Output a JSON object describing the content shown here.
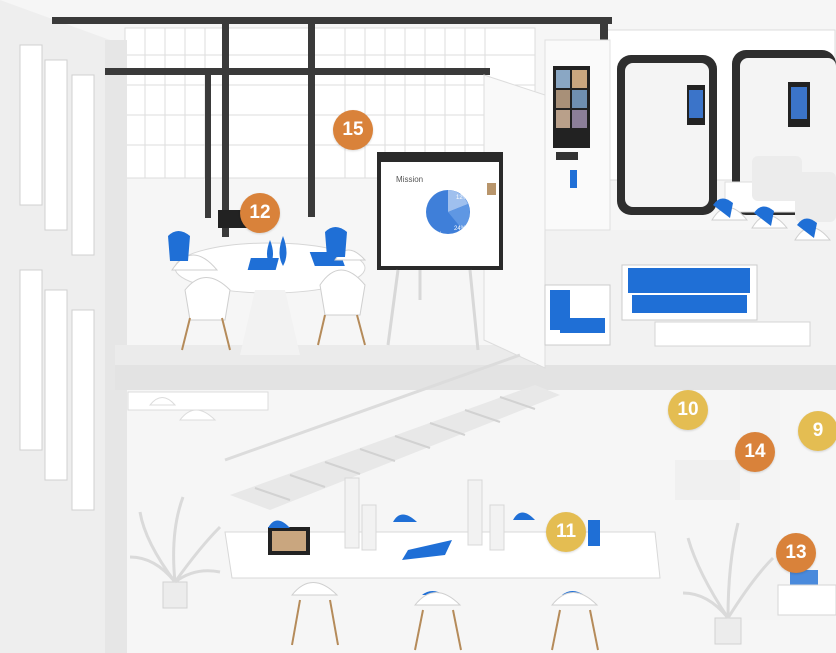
{
  "colors": {
    "accent_blue": "#1f6fd6",
    "marker_orange": "#d9823a",
    "marker_gold": "#e4bd52",
    "frame_dark": "#3a3a3a"
  },
  "screen": {
    "title": "Mission",
    "slices": [
      "12%",
      "24%",
      "64%"
    ]
  },
  "markers": [
    {
      "id": "15",
      "label": "15",
      "tone": "orange"
    },
    {
      "id": "12",
      "label": "12",
      "tone": "orange"
    },
    {
      "id": "10",
      "label": "10",
      "tone": "gold"
    },
    {
      "id": "9",
      "label": "9",
      "tone": "gold"
    },
    {
      "id": "14",
      "label": "14",
      "tone": "orange"
    },
    {
      "id": "11",
      "label": "11",
      "tone": "gold"
    },
    {
      "id": "13",
      "label": "13",
      "tone": "orange"
    }
  ]
}
